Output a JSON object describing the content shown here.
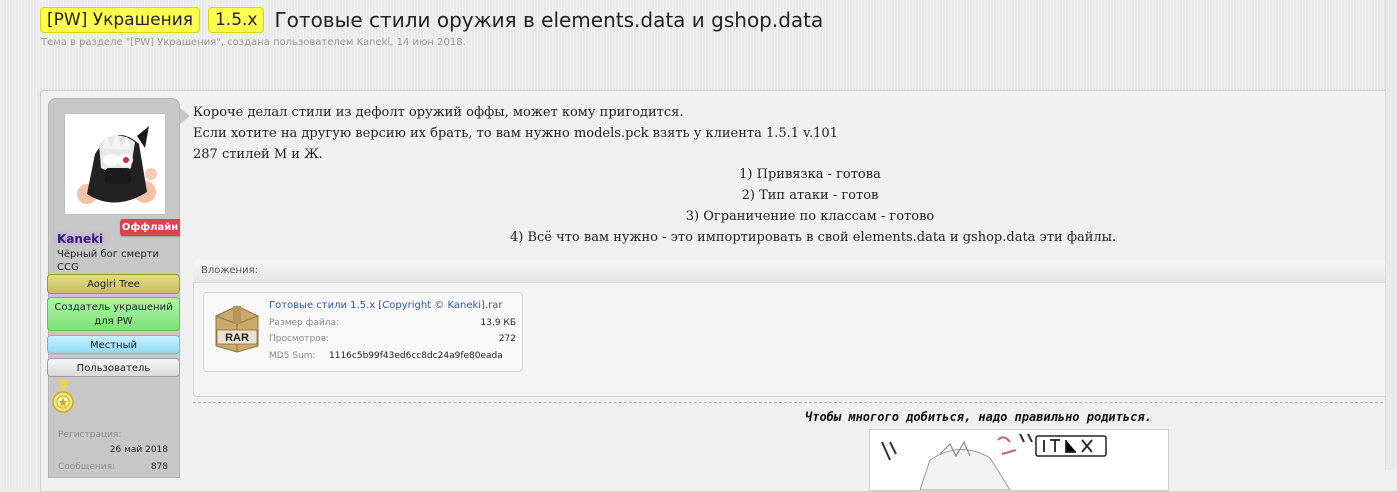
{
  "thread": {
    "prefix_section": "[PW] Украшения",
    "prefix_version": "1.5.x",
    "title": "Готовые стили оружия в elements.data и gshop.data",
    "meta": "Тема в разделе \"[PW] Украшения\", создана пользователем Kaneki, 14 июн 2018."
  },
  "author": {
    "status_badge": "Оффлайн",
    "username": "Kaneki",
    "user_title_line1": "Чёрный бог смерти",
    "user_title_line2": "CCG",
    "badges": [
      "Aogiri Tree",
      "Создатель украшений",
      "для PW",
      "Местный",
      "Пользователь"
    ],
    "stats": {
      "reg_label": "Регистрация:",
      "reg_value": "26 май 2018",
      "msg_label": "Сообщения:",
      "msg_value": "878"
    }
  },
  "post": {
    "lines": [
      "Короче делал стили из дефолт оружий оффы, может кому пригодится.",
      "Если хотите на другую версию их брать, то вам нужно models.pck взять у клиента 1.5.1 v.101",
      "287 стилей М и Ж."
    ],
    "centered_lines": [
      "1) Привязка - готова",
      "2) Тип атаки - готов",
      "3) Ограничение по классам - готово",
      "4) Всё что вам нужно - это импортировать в свой elements.data и gshop.data эти файлы."
    ]
  },
  "attachments": {
    "label": "Вложения:",
    "file": {
      "icon_text": "RAR",
      "name": "Готовые стили 1.5.x [Copyright © Kaneki].rar",
      "size_label": "Размер файла:",
      "size_value": "13,9 КБ",
      "views_label": "Просмотров:",
      "views_value": "272",
      "md5_label": "MD5 Sum:",
      "md5_value": "1116c5b99f43ed6cc8dc24a9fe80eada"
    }
  },
  "signature": {
    "text": "Чтобы многого добиться, надо правильно родиться."
  },
  "colors": {
    "prefix_bg": "#ffff50",
    "offline_badge": "#d9434e",
    "link": "#2b5ba8"
  },
  "icons": [
    "avatar-image",
    "medal-icon",
    "rar-file-icon",
    "signature-image"
  ]
}
